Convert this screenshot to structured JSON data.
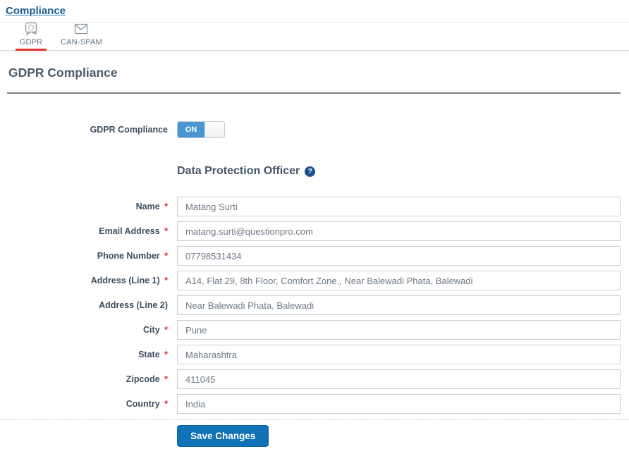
{
  "breadcrumb": {
    "label": "Compliance"
  },
  "tabs": [
    {
      "label": "GDPR",
      "icon": "gdpr-badge-icon",
      "active": true
    },
    {
      "label": "CAN-SPAM",
      "icon": "envelope-icon",
      "active": false
    }
  ],
  "section": {
    "title": "GDPR Compliance",
    "toggle": {
      "label": "GDPR Compliance",
      "state": "ON"
    },
    "subsection": {
      "title": "Data Protection Officer",
      "help_icon": "question-circle-icon",
      "help_glyph": "?"
    }
  },
  "form": {
    "required_marker": "*",
    "fields": [
      {
        "label": "Name",
        "required": true,
        "value": "Matang Surti"
      },
      {
        "label": "Email Address",
        "required": true,
        "value": "matang.surti@questionpro.com"
      },
      {
        "label": "Phone Number",
        "required": true,
        "value": "07798531434"
      },
      {
        "label": "Address (Line 1)",
        "required": true,
        "value": "A14, Flat 29, 8th Floor, Comfort Zone,, Near Balewadi Phata, Balewadi"
      },
      {
        "label": "Address (Line 2)",
        "required": false,
        "value": "Near Balewadi Phata, Balewadi"
      },
      {
        "label": "City",
        "required": true,
        "value": "Pune"
      },
      {
        "label": "State",
        "required": true,
        "value": "Maharashtra"
      },
      {
        "label": "Zipcode",
        "required": true,
        "value": "411045"
      },
      {
        "label": "Country",
        "required": true,
        "value": "India"
      }
    ],
    "save_label": "Save Changes"
  },
  "colors": {
    "accent_blue": "#1172b5",
    "toggle_blue": "#4a96d2",
    "active_tab_red": "#e2312b",
    "required_red": "#d43030",
    "link_blue": "#1a5c94",
    "heading_gray": "#4a5b6c"
  }
}
